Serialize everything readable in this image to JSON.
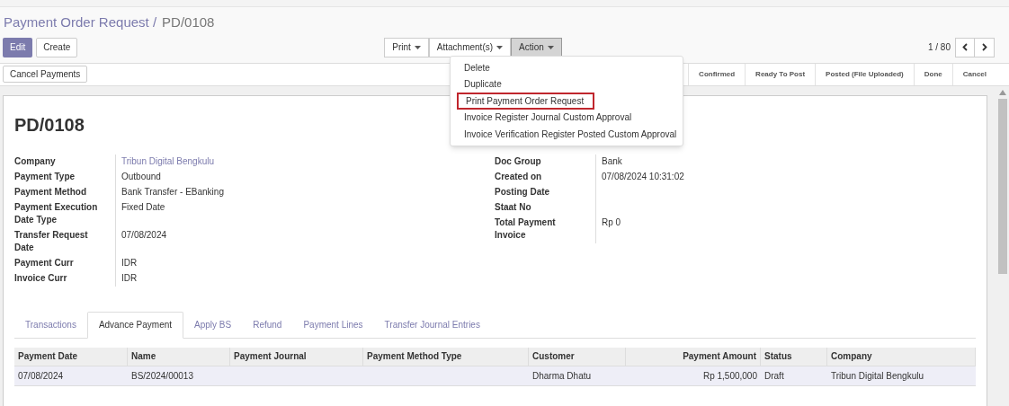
{
  "breadcrumb": {
    "parent": "Payment Order Request /",
    "current": "PD/0108"
  },
  "buttons": {
    "edit": "Edit",
    "create": "Create"
  },
  "toolbar": [
    {
      "label": "Print",
      "open": false
    },
    {
      "label": "Attachment(s)",
      "open": false
    },
    {
      "label": "Action",
      "open": true
    }
  ],
  "pager": {
    "text": "1 / 80"
  },
  "action_menu": [
    {
      "label": "Delete",
      "highlighted": false
    },
    {
      "label": "Duplicate",
      "highlighted": false
    },
    {
      "label": "Print Payment Order Request",
      "highlighted": true
    },
    {
      "label": "Invoice Register Journal Custom Approval",
      "highlighted": false
    },
    {
      "label": "Invoice Verification Register Posted Custom Approval",
      "highlighted": false
    }
  ],
  "cancel_button": "Cancel Payments",
  "stages": [
    "Confirmed",
    "Ready To Post",
    "Posted (File Uploaded)",
    "Done",
    "Cancel"
  ],
  "title": "PD/0108",
  "left_fields": [
    {
      "label": "Company",
      "value": "Tribun Digital Bengkulu",
      "link": true
    },
    {
      "label": "Payment Type",
      "value": "Outbound",
      "link": false
    },
    {
      "label": "Payment Method",
      "value": "Bank Transfer - EBanking",
      "link": false
    },
    {
      "label": "Payment Execution Date Type",
      "value": "Fixed Date",
      "link": false
    },
    {
      "label": "Transfer Request Date",
      "value": "07/08/2024",
      "link": false
    },
    {
      "label": "Payment Curr",
      "value": "IDR",
      "link": false
    },
    {
      "label": "Invoice Curr",
      "value": "IDR",
      "link": false
    }
  ],
  "right_fields": [
    {
      "label": "Doc Group",
      "value": "Bank"
    },
    {
      "label": "Created on",
      "value": "07/08/2024 10:31:02"
    },
    {
      "label": "Posting Date"
    },
    {
      "label": "Staat No"
    },
    {
      "label": "Total Payment Invoice",
      "value": "Rp 0"
    }
  ],
  "tabs": [
    {
      "label": "Transactions",
      "selected": false
    },
    {
      "label": "Advance Payment",
      "selected": true
    },
    {
      "label": "Apply BS",
      "selected": false
    },
    {
      "label": "Refund",
      "selected": false
    },
    {
      "label": "Payment Lines",
      "selected": false
    },
    {
      "label": "Transfer Journal Entries",
      "selected": false
    }
  ],
  "table": {
    "columns": [
      "Payment Date",
      "Name",
      "Payment Journal",
      "Payment Method Type",
      "Customer",
      "Payment Amount",
      "Status",
      "Company"
    ],
    "rows": [
      [
        "07/08/2024",
        "BS/2024/00013",
        "",
        "",
        "Dharma Dhatu",
        "Rp 1,500,000",
        "Draft",
        "Tribun Digital Bengkulu"
      ]
    ]
  }
}
